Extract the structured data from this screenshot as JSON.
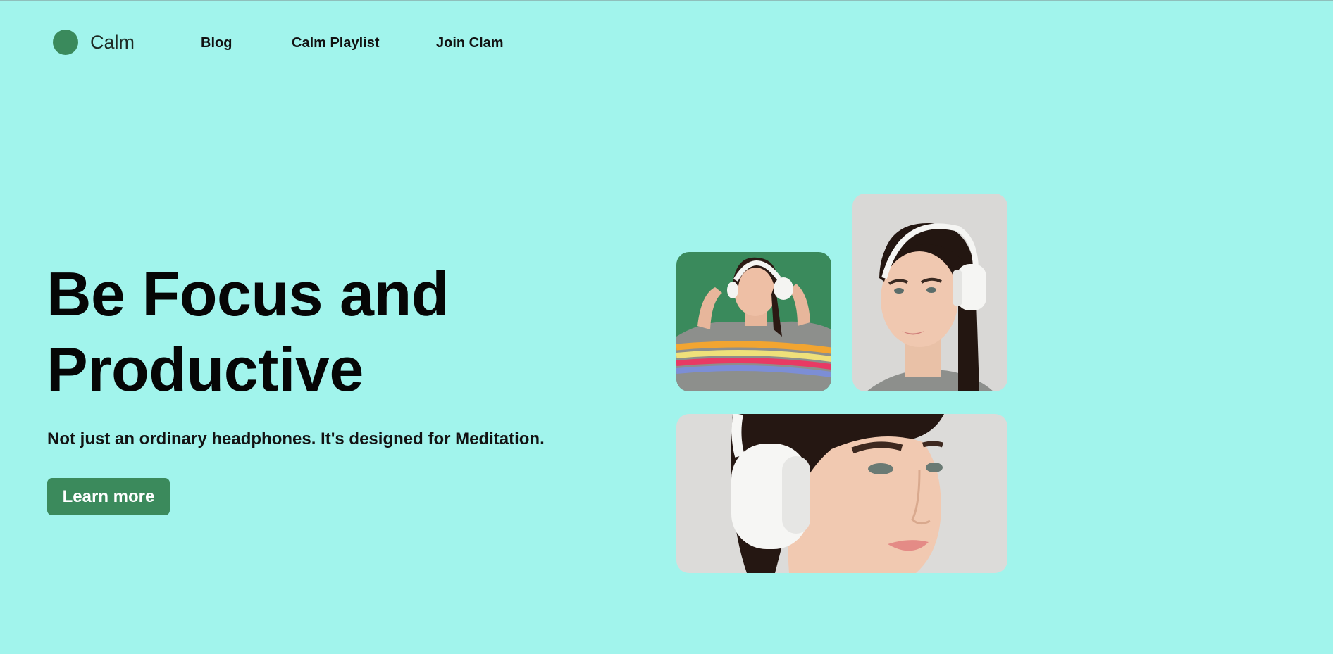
{
  "nav": {
    "brand": "Calm",
    "links": [
      "Blog",
      "Calm Playlist",
      "Join Clam"
    ]
  },
  "hero": {
    "title_line1": "Be Focus and",
    "title_line2": "Productive",
    "subtitle": "Not just an ordinary headphones. It's designed for Meditation.",
    "cta": "Learn more"
  },
  "colors": {
    "background": "#a1f4ec",
    "accent": "#3b8a5c",
    "text": "#060606"
  },
  "icons": [
    "logo-dot-icon"
  ]
}
